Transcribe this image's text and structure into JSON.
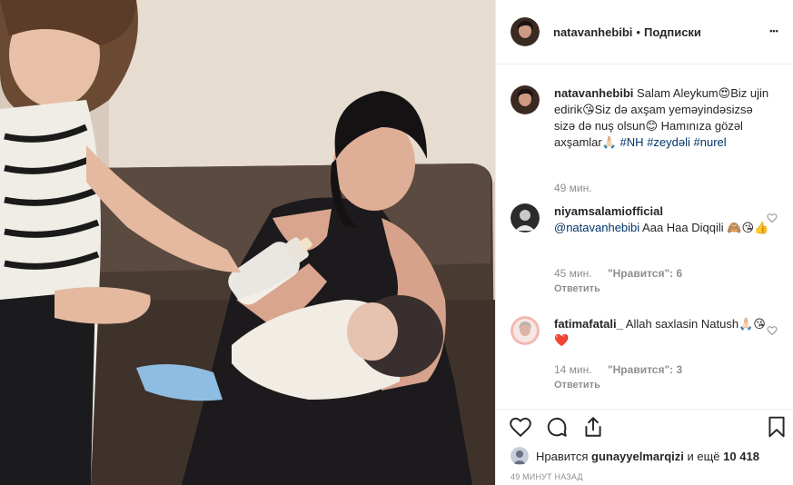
{
  "post": {
    "photo": {
      "icon": "photo-image"
    },
    "header": {
      "username": "natavanhebibi",
      "separator": "•",
      "follow_label": "Подписки",
      "more_icon": "more-horizontal-icon",
      "more_label": "•••"
    },
    "caption": {
      "username": "natavanhebibi",
      "text_1": "Salam Aleykum😍Biz ujin edirik😘Siz də axşam yeməyindəsizsə sizə də nuş olsun😊 Hamınıza gözəl axşamlar🙏🏻 ",
      "hashtag_1": "#NH",
      "hashtag_2": "#zeydəli",
      "hashtag_3": "#nurel",
      "time": "49 мин."
    },
    "comments": [
      {
        "username": "niyamsalamiofficial",
        "mention": "@natavanhebibi",
        "text": " Aaa Haa Diqqili 🙈😘👍",
        "time": "45 мин.",
        "likes": "\"Нравится\": 6",
        "reply_label": "Ответить"
      },
      {
        "username": "fatimafatali_",
        "text": " Allah saxlasin Natush🙏🏻😘❤️",
        "time": "14 мин.",
        "likes": "\"Нравится\": 3",
        "reply_label": "Ответить"
      }
    ],
    "actions": {
      "like_icon": "heart-icon",
      "comment_icon": "comment-icon",
      "share_icon": "share-icon",
      "save_icon": "bookmark-icon"
    },
    "liked_by": {
      "prefix": "Нравится",
      "user": "gunayyelmarqizi",
      "suffix_word": "и ещё",
      "count": "10 418"
    },
    "timestamp": "49 МИНУТ НАЗАД"
  },
  "colors": {
    "text": "#262626",
    "muted": "#8e8e8e",
    "link": "#003569",
    "border": "#efefef"
  }
}
